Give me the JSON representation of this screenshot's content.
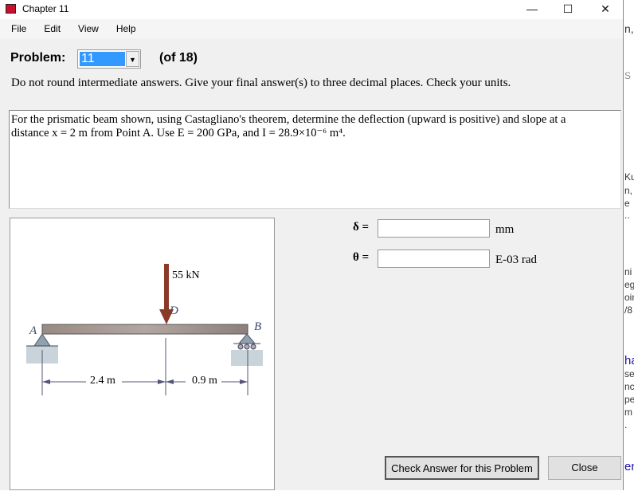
{
  "window": {
    "title": "Chapter 11",
    "minimize": "—",
    "maximize": "☐",
    "close": "✕"
  },
  "menu": [
    "File",
    "Edit",
    "View",
    "Help"
  ],
  "problem": {
    "label": "Problem:",
    "selected": "11",
    "of": "(of 18)"
  },
  "instructions": "Do not round intermediate answers.  Give your final answer(s) to three decimal places.  Check your units.",
  "question": {
    "line1": "For the prismatic beam shown, using Castagliano's theorem, determine the deflection (upward is positive) and slope at a",
    "line2": "distance x = 2 m from Point A.  Use E = 200 GPa, and I  = 28.9×10⁻⁶  m⁴."
  },
  "figure": {
    "load": "55 kN",
    "point_a": "A",
    "point_b": "B",
    "point_d": "D",
    "dim1": "2.4 m",
    "dim2": "0.9 m",
    "load_color": "#8b3a2a"
  },
  "answers": [
    {
      "symbol": "δ =",
      "value": "",
      "unit": "mm"
    },
    {
      "symbol": "θ =",
      "value": "",
      "unit": "E-03 rad"
    }
  ],
  "buttons": {
    "check": "Check Answer for this Problem",
    "close": "Close"
  },
  "background_fragments": [
    "n,",
    "S",
    "Ku",
    "n,",
    "e",
    "..",
    "ni",
    "eg",
    "oin",
    "/8",
    "ha",
    "se",
    "nc",
    "pe",
    "m",
    ".",
    "en"
  ]
}
